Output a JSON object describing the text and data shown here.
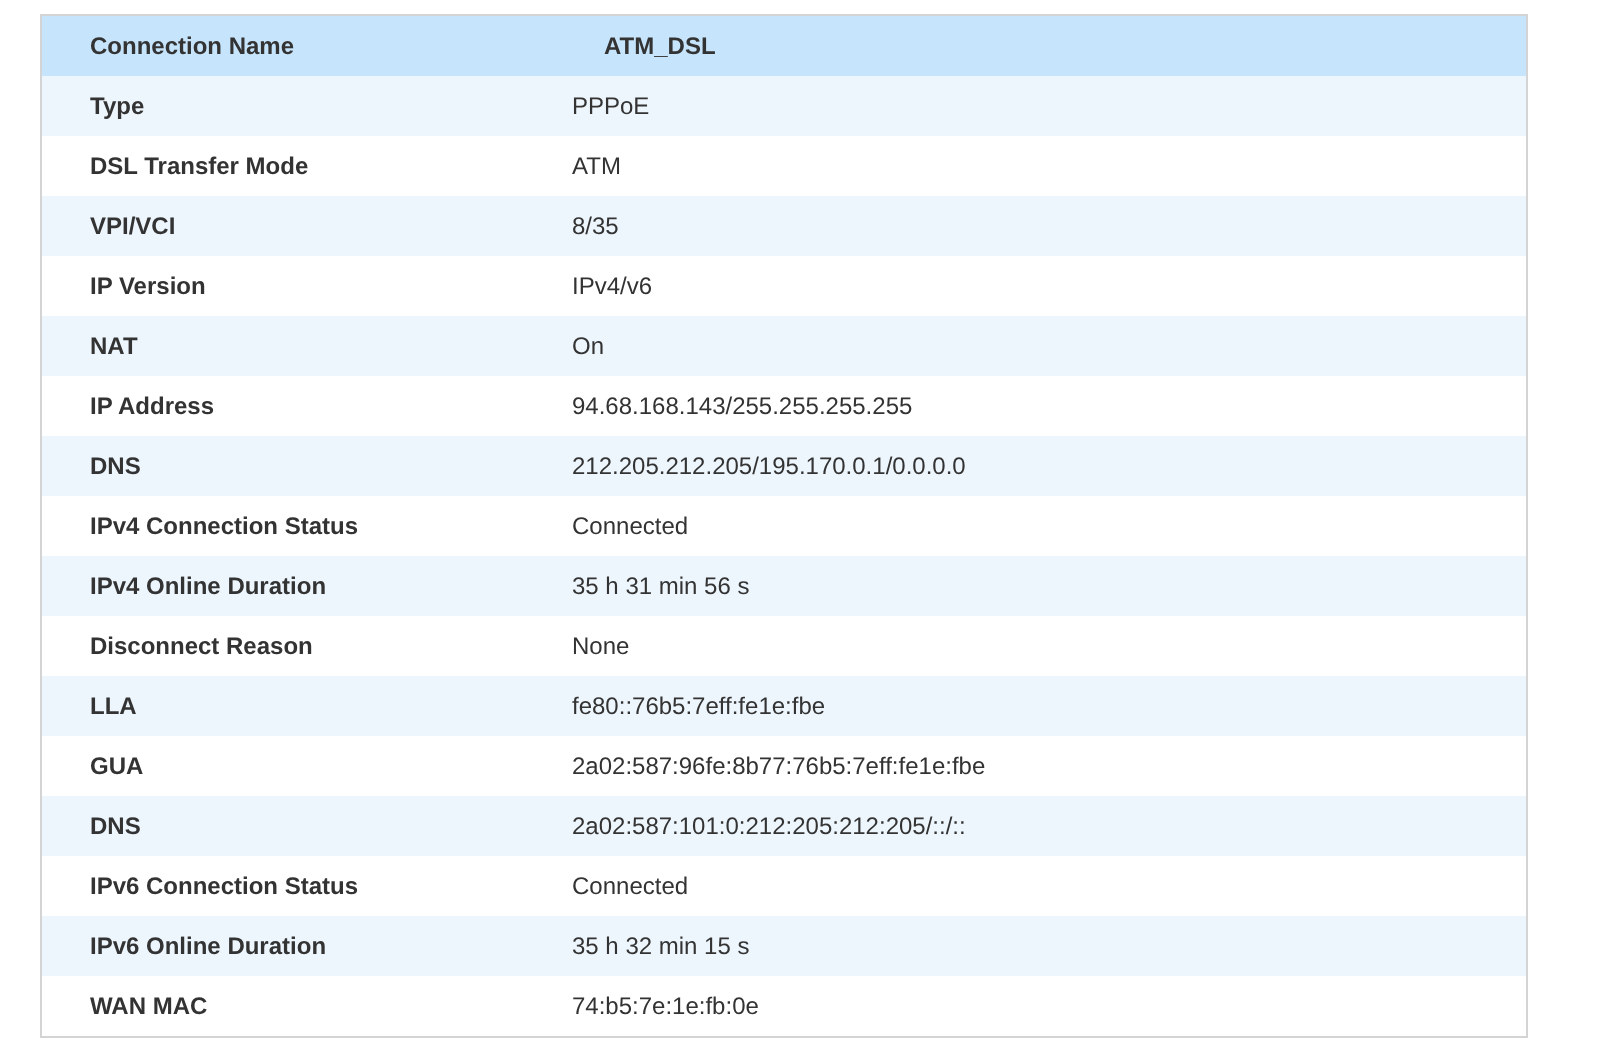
{
  "header": {
    "label": "Connection Name",
    "value": "ATM_DSL"
  },
  "rows": [
    {
      "label": "Type",
      "value": "PPPoE"
    },
    {
      "label": "DSL Transfer Mode",
      "value": "ATM"
    },
    {
      "label": "VPI/VCI",
      "value": "8/35"
    },
    {
      "label": "IP Version",
      "value": "IPv4/v6"
    },
    {
      "label": "NAT",
      "value": "On"
    },
    {
      "label": "IP Address",
      "value": "94.68.168.143/255.255.255.255"
    },
    {
      "label": "DNS",
      "value": "212.205.212.205/195.170.0.1/0.0.0.0"
    },
    {
      "label": "IPv4 Connection Status",
      "value": "Connected"
    },
    {
      "label": "IPv4 Online Duration",
      "value": "35 h 31 min 56 s"
    },
    {
      "label": "Disconnect Reason",
      "value": "None"
    },
    {
      "label": "LLA",
      "value": "fe80::76b5:7eff:fe1e:fbe"
    },
    {
      "label": "GUA",
      "value": "2a02:587:96fe:8b77:76b5:7eff:fe1e:fbe"
    },
    {
      "label": "DNS",
      "value": "2a02:587:101:0:212:205:212:205/::/::"
    },
    {
      "label": "IPv6 Connection Status",
      "value": "Connected"
    },
    {
      "label": "IPv6 Online Duration",
      "value": "35 h 32 min 15 s"
    },
    {
      "label": "WAN MAC",
      "value": "74:b5:7e:1e:fb:0e"
    }
  ]
}
